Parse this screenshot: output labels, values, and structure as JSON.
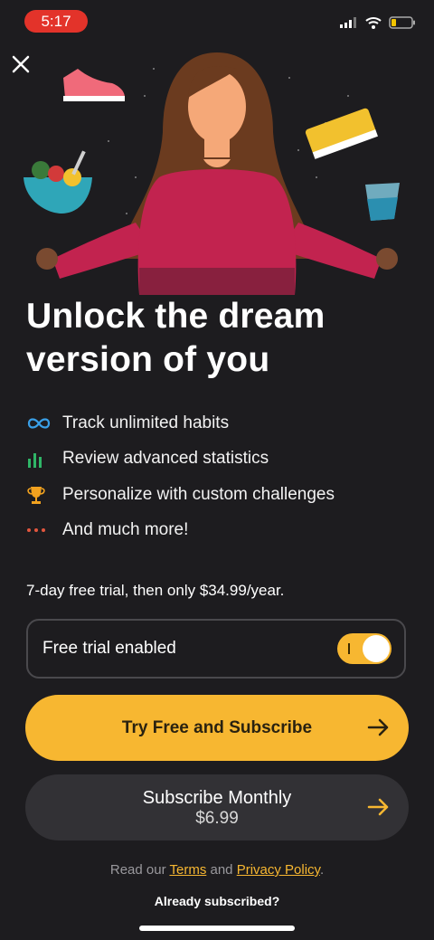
{
  "status": {
    "time": "5:17"
  },
  "hero": {
    "description": "illustration-meditating-woman"
  },
  "headline": "Unlock the dream version of you",
  "features": [
    {
      "icon": "infinity-icon",
      "label": "Track unlimited habits"
    },
    {
      "icon": "bar-chart-icon",
      "label": "Review advanced statistics"
    },
    {
      "icon": "trophy-icon",
      "label": "Personalize with custom challenges"
    },
    {
      "icon": "more-dots-icon",
      "label": "And much more!"
    }
  ],
  "pricing": {
    "text": "7-day free trial, then only $34.99/year."
  },
  "trial": {
    "label": "Free trial enabled",
    "enabled": true
  },
  "primary_button": {
    "label": "Try Free and Subscribe"
  },
  "secondary_button": {
    "label": "Subscribe Monthly",
    "price": "$6.99"
  },
  "legal": {
    "prefix": "Read our ",
    "terms": "Terms",
    "and": " and ",
    "privacy": "Privacy Policy",
    "suffix": "."
  },
  "already_subscribed": "Already subscribed?",
  "colors": {
    "accent": "#f7b731",
    "background": "#1d1c1f",
    "time_pill": "#e3332a"
  }
}
